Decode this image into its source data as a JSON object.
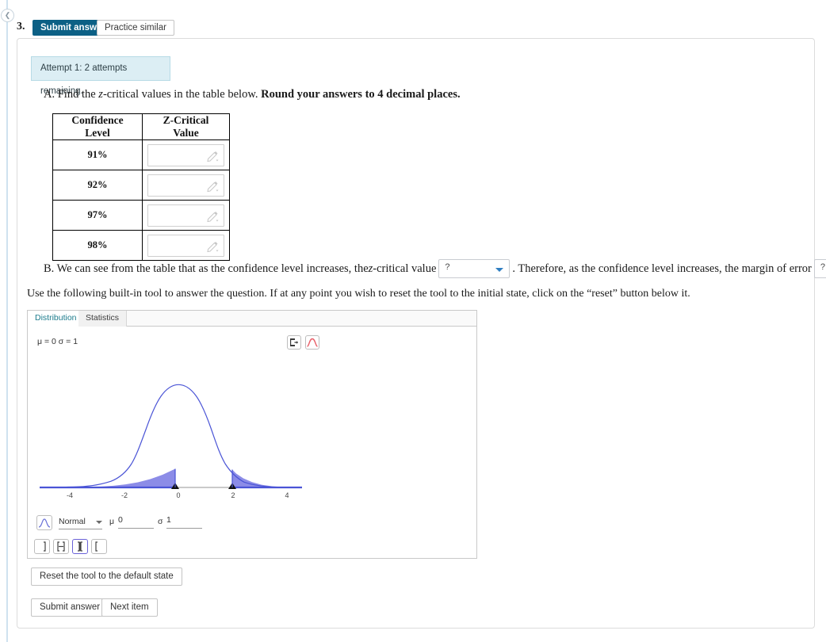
{
  "question": {
    "number": "3.",
    "submit_label": "Submit answer",
    "practice_label": "Practice similar",
    "attempt_text": "Attempt 1: 2 attempts remaining."
  },
  "part_a": {
    "prefix": "A. Find the ",
    "italic": "z",
    "middle": "-critical values in the table below. ",
    "bold": "Round your answers to 4 decimal places.",
    "table": {
      "headers": [
        "Confidence Level",
        "Z-Critical Value"
      ],
      "rows": [
        {
          "level": "91%",
          "value": ""
        },
        {
          "level": "92%",
          "value": ""
        },
        {
          "level": "97%",
          "value": ""
        },
        {
          "level": "98%",
          "value": ""
        }
      ]
    }
  },
  "part_b": {
    "text_1": "B. We can see from the table that as the confidence level increases, the ",
    "italic_z": "z",
    "text_2": "-critical value",
    "dropdown_1": "?",
    "text_3": ". Therefore, as the confidence level increases, the margin of error",
    "dropdown_2": "?",
    "text_4": "."
  },
  "instruction": "Use the following built-in tool to answer the question. If at any point you wish to reset the tool to the initial state, click on the “reset” button below it.",
  "tool": {
    "tabs": [
      {
        "label": "Distribution",
        "active": true
      },
      {
        "label": "Statistics",
        "active": false
      }
    ],
    "params_text": "μ = 0 σ = 1",
    "export_icon": "export-icon",
    "curve_icon": "distribution-curve-icon",
    "distribution_name": "Normal",
    "mu_label": "μ",
    "mu_value": "0",
    "sigma_label": "σ",
    "sigma_value": "1",
    "tail_buttons": [
      {
        "name": "left-tail",
        "selected": false
      },
      {
        "name": "between",
        "selected": false
      },
      {
        "name": "two-tails",
        "selected": true
      },
      {
        "name": "right-tail",
        "selected": false
      }
    ]
  },
  "chart_data": {
    "type": "line",
    "title": "",
    "xlabel": "",
    "ylabel": "",
    "distribution": "Normal",
    "mu": 0,
    "sigma": 1,
    "xlim": [
      -5,
      5
    ],
    "ylim": [
      0,
      0.42
    ],
    "xticks": [
      -4,
      -2,
      0,
      2,
      4
    ],
    "xticklabels": [
      "-4",
      "-2",
      "0",
      "2",
      "4"
    ],
    "grid": false,
    "legend": "none",
    "curve_color": "#4a54d6",
    "shade_color": "#6b6be0",
    "shaded_regions": [
      {
        "from": -5,
        "to": -1.0
      },
      {
        "from": 1.95,
        "to": 5
      }
    ],
    "markers": [
      {
        "x": -1.0,
        "label": ""
      },
      {
        "x": 1.95,
        "label": ""
      }
    ],
    "x": [
      -5,
      -4.5,
      -4,
      -3.5,
      -3,
      -2.5,
      -2,
      -1.5,
      -1,
      -0.5,
      0,
      0.5,
      1,
      1.5,
      2,
      2.5,
      3,
      3.5,
      4,
      4.5,
      5
    ],
    "y": [
      0.0,
      0.0,
      0.0001,
      0.0009,
      0.0044,
      0.0175,
      0.054,
      0.1295,
      0.242,
      0.3521,
      0.3989,
      0.3521,
      0.242,
      0.1295,
      0.054,
      0.0175,
      0.0044,
      0.0009,
      0.0001,
      0.0,
      0.0
    ]
  },
  "footer": {
    "reset_label": "Reset the tool to the default state",
    "submit_label": "Submit answer",
    "next_label": "Next item"
  },
  "colors": {
    "primary": "#0c6085",
    "badge_bg": "#dceef4",
    "badge_border": "#b7dbe6",
    "tab_active": "#1b7b8c",
    "curve": "#4a54d6",
    "shade": "#6b6be0",
    "selected_border": "#6a62d8"
  }
}
